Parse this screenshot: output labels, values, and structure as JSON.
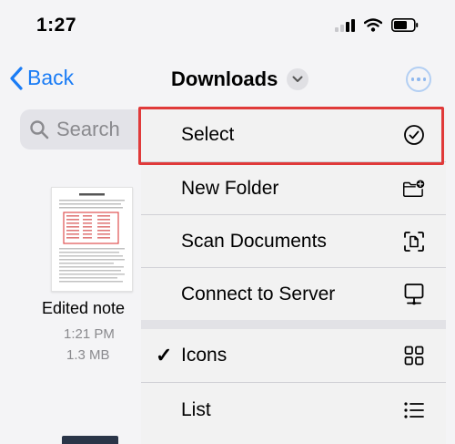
{
  "status_bar": {
    "time": "1:27"
  },
  "nav": {
    "back_label": "Back",
    "title": "Downloads"
  },
  "search": {
    "placeholder": "Search"
  },
  "file": {
    "name": "Edited note",
    "time": "1:21 PM",
    "size": "1.3 MB"
  },
  "menu": {
    "items": [
      {
        "label": "Select",
        "icon": "checkmark-circle-icon"
      },
      {
        "label": "New Folder",
        "icon": "folder-plus-icon"
      },
      {
        "label": "Scan Documents",
        "icon": "scan-document-icon"
      },
      {
        "label": "Connect to Server",
        "icon": "server-display-icon"
      },
      {
        "label": "Icons",
        "icon": "grid-icon",
        "checked": true
      },
      {
        "label": "List",
        "icon": "list-icon"
      }
    ],
    "checkmark": "✓"
  },
  "colors": {
    "accent": "#1a7cf5",
    "highlight": "#e03a3a",
    "menu_bg": "#f2f2f2"
  }
}
